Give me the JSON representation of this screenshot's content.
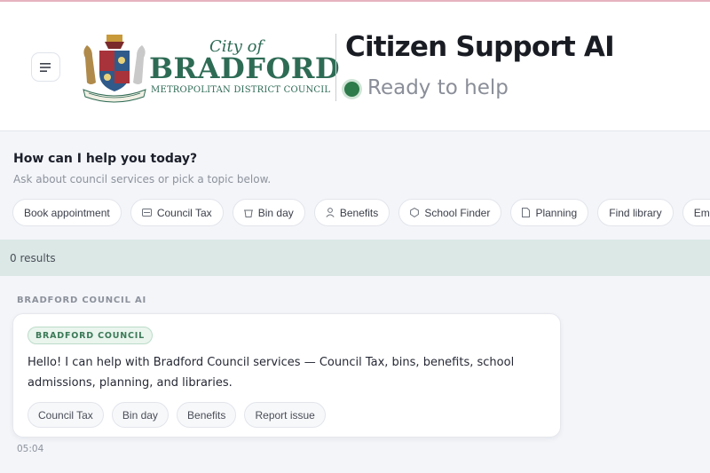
{
  "header": {
    "menu_icon": "menu-icon",
    "logo": {
      "city_of": "City of",
      "name": "BRADFORD",
      "subtitle": "METROPOLITAN DISTRICT COUNCIL",
      "crest_icon": "crest-icon",
      "color": "#2e6b55"
    },
    "title": "Citizen Support AI",
    "status": {
      "text": "Ready to help",
      "dot_color": "#2d7a4a"
    }
  },
  "intro": {
    "title": "How can I help you today?",
    "subtitle": "Ask about council services or pick a topic below."
  },
  "topics": [
    {
      "label": "Book appointment",
      "icon": ""
    },
    {
      "label": "Council Tax",
      "icon": "card-icon"
    },
    {
      "label": "Bin day",
      "icon": "bin-icon"
    },
    {
      "label": "Benefits",
      "icon": "person-icon"
    },
    {
      "label": "School Finder",
      "icon": "shield-icon"
    },
    {
      "label": "Planning",
      "icon": "document-icon"
    },
    {
      "label": "Find library",
      "icon": ""
    },
    {
      "label": "Eme",
      "icon": ""
    }
  ],
  "results": {
    "text": "0 results"
  },
  "conversation": {
    "sender_label": "BRADFORD COUNCIL AI",
    "message": {
      "badge": "BRADFORD COUNCIL",
      "text": "Hello! I can help with Bradford Council services — Council Tax, bins, benefits, school admissions, planning, and libraries.",
      "quick_replies": [
        "Council Tax",
        "Bin day",
        "Benefits",
        "Report issue"
      ],
      "time": "05:04"
    }
  }
}
